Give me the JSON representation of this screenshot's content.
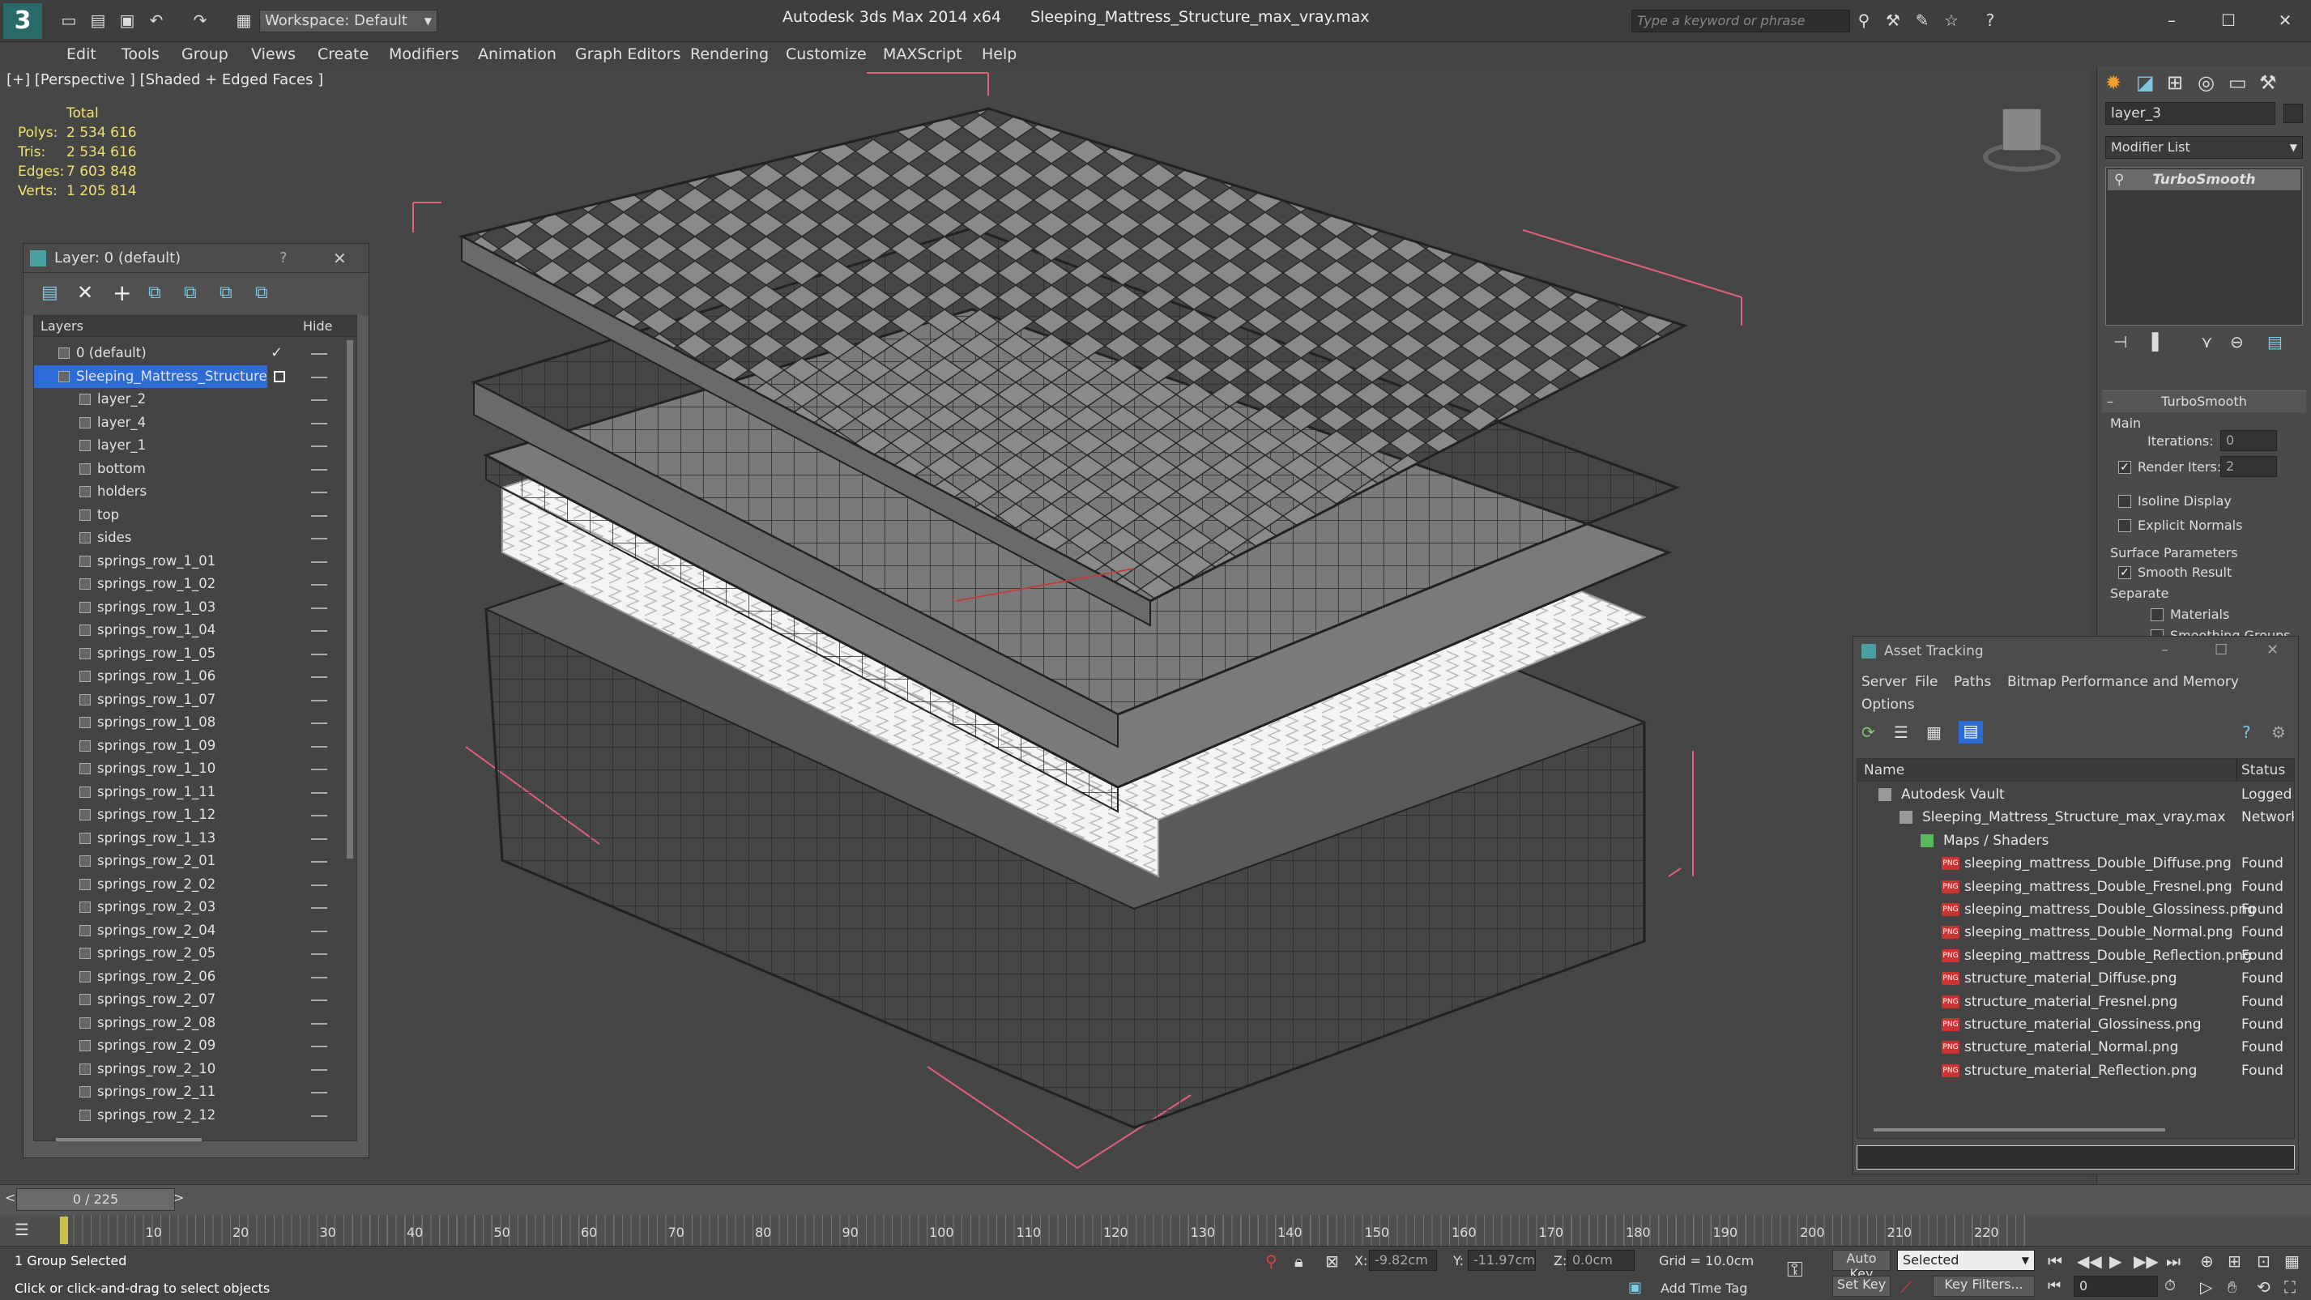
{
  "titlebar": {
    "workspace": "Workspace: Default",
    "app_title": "Autodesk 3ds Max  2014 x64",
    "file_title": "Sleeping_Mattress_Structure_max_vray.max",
    "search_placeholder": "Type a keyword or phrase"
  },
  "menu": [
    "Edit",
    "Tools",
    "Group",
    "Views",
    "Create",
    "Modifiers",
    "Animation",
    "Graph Editors",
    "Rendering",
    "Customize",
    "MAXScript",
    "Help"
  ],
  "viewport": {
    "label": "[+] [Perspective ] [Shaded + Edged Faces ]",
    "stats_header": "Total",
    "stats": [
      {
        "label": "Polys:",
        "value": "2 534 616"
      },
      {
        "label": "Tris:",
        "value": "2 534 616"
      },
      {
        "label": "Edges:",
        "value": "7 603 848"
      },
      {
        "label": "Verts:",
        "value": "1 205 814"
      }
    ]
  },
  "layer_panel": {
    "title": "Layer: 0 (default)",
    "help": "?",
    "col_layers": "Layers",
    "col_hide": "Hide",
    "rows": [
      {
        "name": "0 (default)",
        "indent": 0
      },
      {
        "name": "Sleeping_Mattress_Structure",
        "indent": 0
      },
      {
        "name": "layer_2",
        "indent": 1
      },
      {
        "name": "layer_4",
        "indent": 1
      },
      {
        "name": "layer_1",
        "indent": 1
      },
      {
        "name": "bottom",
        "indent": 1
      },
      {
        "name": "holders",
        "indent": 1
      },
      {
        "name": "top",
        "indent": 1
      },
      {
        "name": "sides",
        "indent": 1
      },
      {
        "name": "springs_row_1_01",
        "indent": 1
      },
      {
        "name": "springs_row_1_02",
        "indent": 1
      },
      {
        "name": "springs_row_1_03",
        "indent": 1
      },
      {
        "name": "springs_row_1_04",
        "indent": 1
      },
      {
        "name": "springs_row_1_05",
        "indent": 1
      },
      {
        "name": "springs_row_1_06",
        "indent": 1
      },
      {
        "name": "springs_row_1_07",
        "indent": 1
      },
      {
        "name": "springs_row_1_08",
        "indent": 1
      },
      {
        "name": "springs_row_1_09",
        "indent": 1
      },
      {
        "name": "springs_row_1_10",
        "indent": 1
      },
      {
        "name": "springs_row_1_11",
        "indent": 1
      },
      {
        "name": "springs_row_1_12",
        "indent": 1
      },
      {
        "name": "springs_row_1_13",
        "indent": 1
      },
      {
        "name": "springs_row_2_01",
        "indent": 1
      },
      {
        "name": "springs_row_2_02",
        "indent": 1
      },
      {
        "name": "springs_row_2_03",
        "indent": 1
      },
      {
        "name": "springs_row_2_04",
        "indent": 1
      },
      {
        "name": "springs_row_2_05",
        "indent": 1
      },
      {
        "name": "springs_row_2_06",
        "indent": 1
      },
      {
        "name": "springs_row_2_07",
        "indent": 1
      },
      {
        "name": "springs_row_2_08",
        "indent": 1
      },
      {
        "name": "springs_row_2_09",
        "indent": 1
      },
      {
        "name": "springs_row_2_10",
        "indent": 1
      },
      {
        "name": "springs_row_2_11",
        "indent": 1
      },
      {
        "name": "springs_row_2_12",
        "indent": 1
      }
    ]
  },
  "command_panel": {
    "object_name": "layer_3",
    "modifier_list": "Modifier List",
    "stack_item": "TurboSmooth",
    "rollout_title": "TurboSmooth",
    "main_label": "Main",
    "iterations_label": "Iterations:",
    "iterations_value": "0",
    "render_iters_label": "Render Iters:",
    "render_iters_value": "2",
    "isoline": "Isoline Display",
    "explicit_normals": "Explicit Normals",
    "surface_params": "Surface Parameters",
    "smooth_result": "Smooth Result",
    "separate": "Separate",
    "materials": "Materials",
    "smoothing_groups": "Smoothing Groups"
  },
  "asset_tracking": {
    "title": "Asset Tracking",
    "menu": [
      "Server",
      "File",
      "Paths",
      "Bitmap Performance and Memory"
    ],
    "options": "Options",
    "col_name": "Name",
    "col_status": "Status",
    "rows": [
      {
        "name": "Autodesk Vault",
        "status": "Logged",
        "level": 0,
        "icon": "vault"
      },
      {
        "name": "Sleeping_Mattress_Structure_max_vray.max",
        "status": "Network",
        "level": 1,
        "icon": "file"
      },
      {
        "name": "Maps / Shaders",
        "status": "",
        "level": 2,
        "icon": "maps"
      },
      {
        "name": "sleeping_mattress_Double_Diffuse.png",
        "status": "Found",
        "level": 3,
        "icon": "png"
      },
      {
        "name": "sleeping_mattress_Double_Fresnel.png",
        "status": "Found",
        "level": 3,
        "icon": "png"
      },
      {
        "name": "sleeping_mattress_Double_Glossiness.png",
        "status": "Found",
        "level": 3,
        "icon": "png"
      },
      {
        "name": "sleeping_mattress_Double_Normal.png",
        "status": "Found",
        "level": 3,
        "icon": "png"
      },
      {
        "name": "sleeping_mattress_Double_Reflection.png",
        "status": "Found",
        "level": 3,
        "icon": "png"
      },
      {
        "name": "structure_material_Diffuse.png",
        "status": "Found",
        "level": 3,
        "icon": "png"
      },
      {
        "name": "structure_material_Fresnel.png",
        "status": "Found",
        "level": 3,
        "icon": "png"
      },
      {
        "name": "structure_material_Glossiness.png",
        "status": "Found",
        "level": 3,
        "icon": "png"
      },
      {
        "name": "structure_material_Normal.png",
        "status": "Found",
        "level": 3,
        "icon": "png"
      },
      {
        "name": "structure_material_Reflection.png",
        "status": "Found",
        "level": 3,
        "icon": "png"
      }
    ]
  },
  "timeline": {
    "frame": "0 / 225",
    "ticks": [
      "10",
      "20",
      "30",
      "40",
      "50",
      "60",
      "70",
      "80",
      "90",
      "100",
      "110",
      "120",
      "130",
      "140",
      "150",
      "160",
      "170",
      "180",
      "190",
      "200",
      "210",
      "220"
    ]
  },
  "status": {
    "selection": "1 Group Selected",
    "prompt": "Click or click-and-drag to select objects",
    "x_label": "X:",
    "x_value": "-9.82cm",
    "y_label": "Y:",
    "y_value": "-11.97cm",
    "z_label": "Z:",
    "z_value": "0.0cm",
    "grid": "Grid = 10.0cm",
    "auto_key": "Auto Key",
    "selected": "Selected",
    "set_key": "Set Key",
    "key_filters": "Key Filters...",
    "add_time_tag": "Add Time Tag",
    "frame_value": "0"
  },
  "colors": {
    "selection_blue": "#2d6bd6",
    "stats_yellow": "#f0e070",
    "bbox_pink": "#e0607a"
  }
}
